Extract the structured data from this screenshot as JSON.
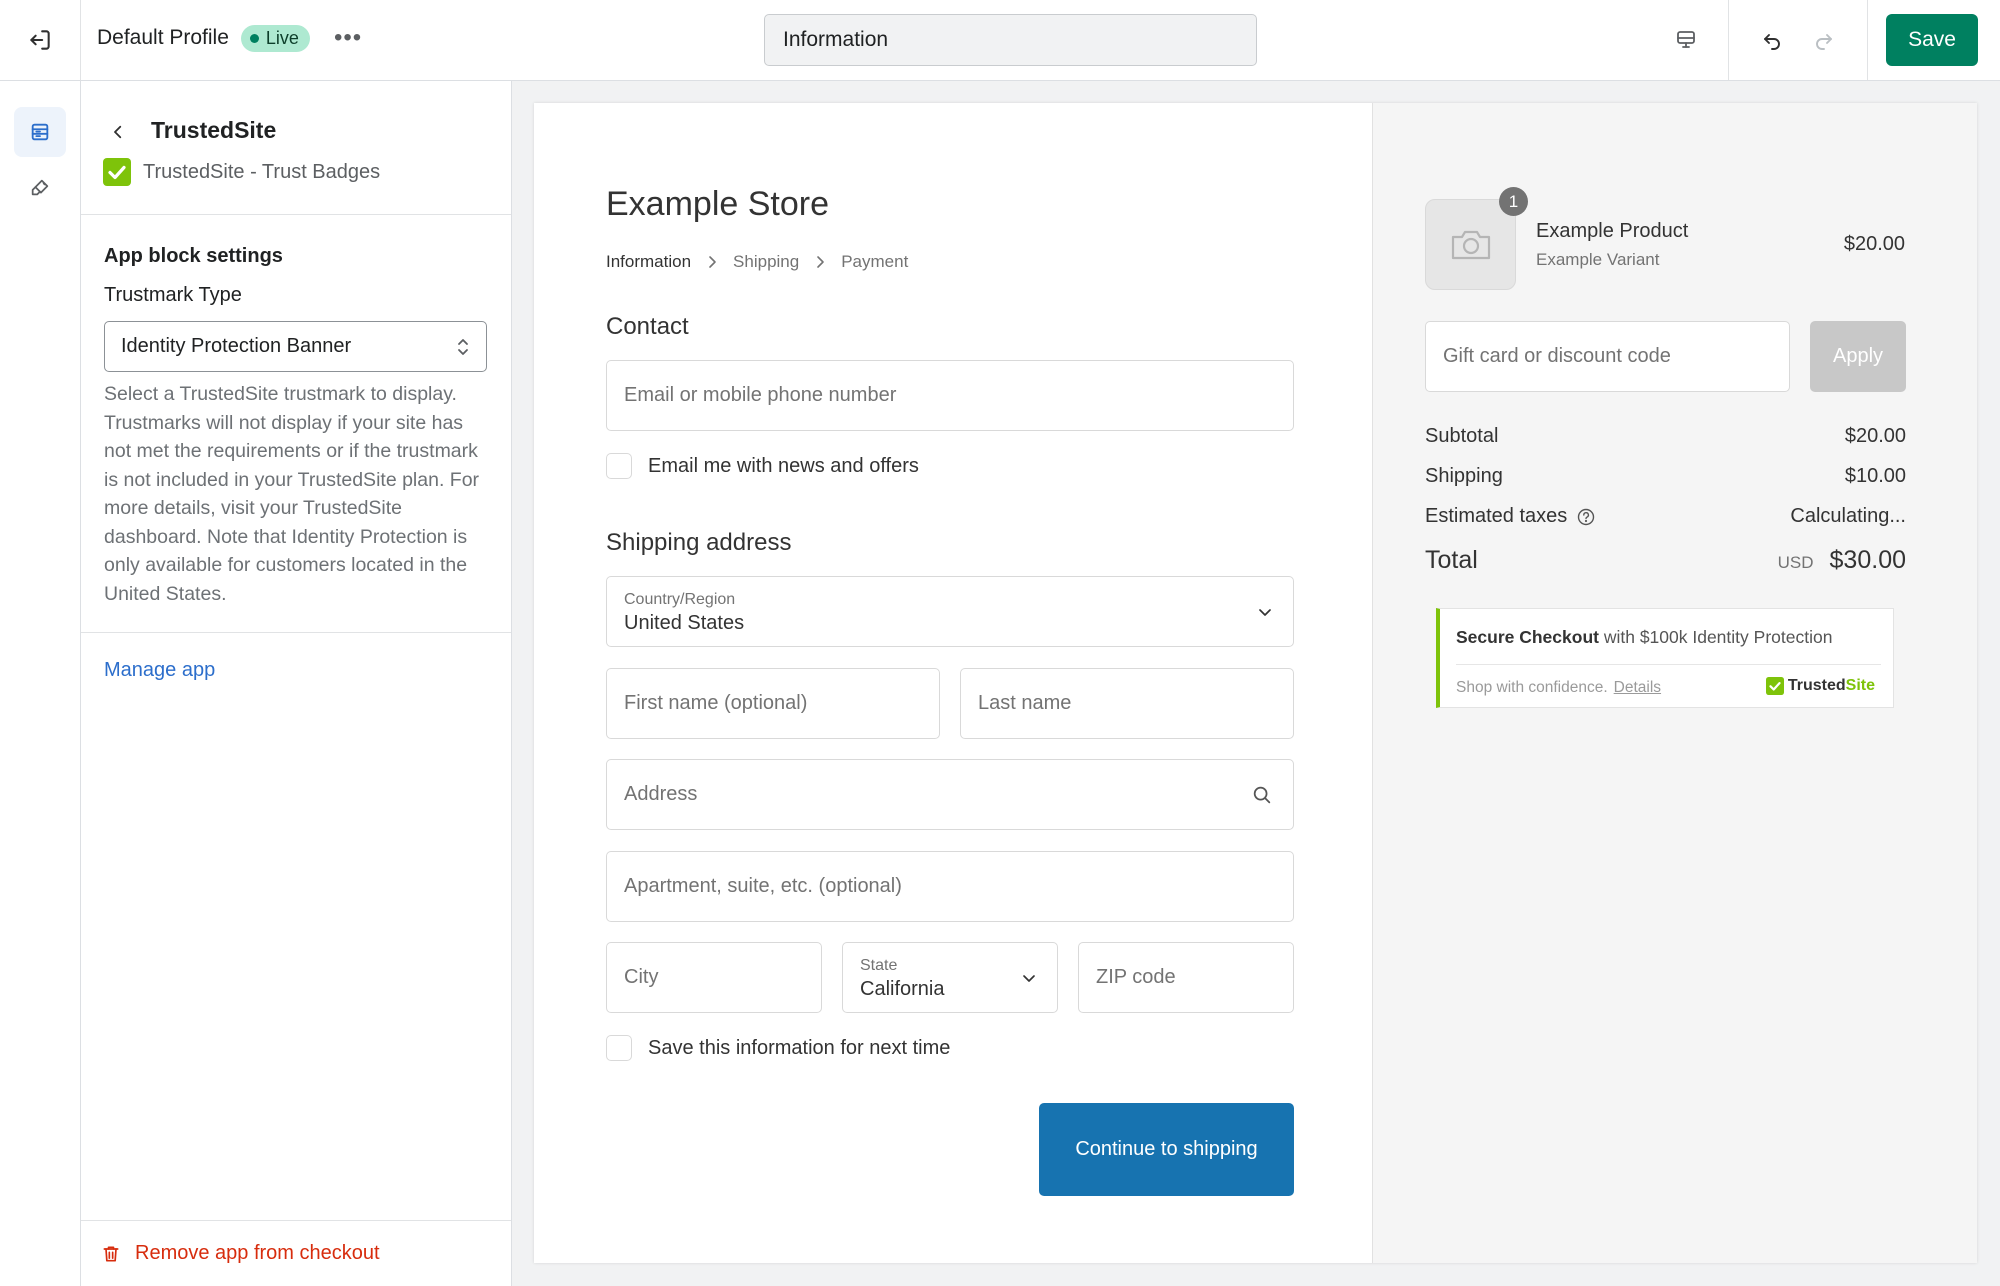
{
  "topbar": {
    "profile_name": "Default Profile",
    "live_label": "Live",
    "page_selector": "Information",
    "save_label": "Save"
  },
  "panel": {
    "title": "TrustedSite",
    "app_name": "TrustedSite - Trust Badges",
    "block_heading": "App block settings",
    "field_label": "Trustmark Type",
    "field_value": "Identity Protection Banner",
    "help_text": "Select a TrustedSite trustmark to display. Trustmarks will not display if your site has not met the requirements or if the trustmark is not included in your TrustedSite plan. For more details, visit your TrustedSite dashboard. Note that Identity Protection is only available for customers located in the United States.",
    "manage_link": "Manage app",
    "remove_label": "Remove app from checkout"
  },
  "checkout": {
    "store_name": "Example Store",
    "breadcrumbs": [
      "Information",
      "Shipping",
      "Payment"
    ],
    "contact_heading": "Contact",
    "email_placeholder": "Email or mobile phone number",
    "news_label": "Email me with news and offers",
    "shipping_heading": "Shipping address",
    "country_label": "Country/Region",
    "country_value": "United States",
    "first_name_placeholder": "First name (optional)",
    "last_name_placeholder": "Last name",
    "address_placeholder": "Address",
    "apartment_placeholder": "Apartment, suite, etc. (optional)",
    "city_placeholder": "City",
    "state_label": "State",
    "state_value": "California",
    "zip_placeholder": "ZIP code",
    "save_info_label": "Save this information for next time",
    "continue_label": "Continue to shipping"
  },
  "summary": {
    "quantity": "1",
    "product_name": "Example Product",
    "product_variant": "Example Variant",
    "product_price": "$20.00",
    "discount_placeholder": "Gift card or discount code",
    "apply_label": "Apply",
    "subtotal_label": "Subtotal",
    "subtotal_value": "$20.00",
    "shipping_label": "Shipping",
    "shipping_value": "$10.00",
    "taxes_label": "Estimated taxes",
    "taxes_value": "Calculating...",
    "total_label": "Total",
    "currency": "USD",
    "total_value": "$30.00"
  },
  "trust_banner": {
    "heading_bold": "Secure Checkout",
    "heading_rest": " with $100k Identity Protection",
    "tagline": "Shop with confidence.",
    "details_link": "Details",
    "logo_text_a": "Trusted",
    "logo_text_b": "Site",
    "accent_color": "#7ec30a"
  },
  "colors": {
    "save_green": "#008060",
    "primary_blue": "#1773b0",
    "danger_red": "#d72c0d",
    "link_blue": "#2c6ecb"
  }
}
